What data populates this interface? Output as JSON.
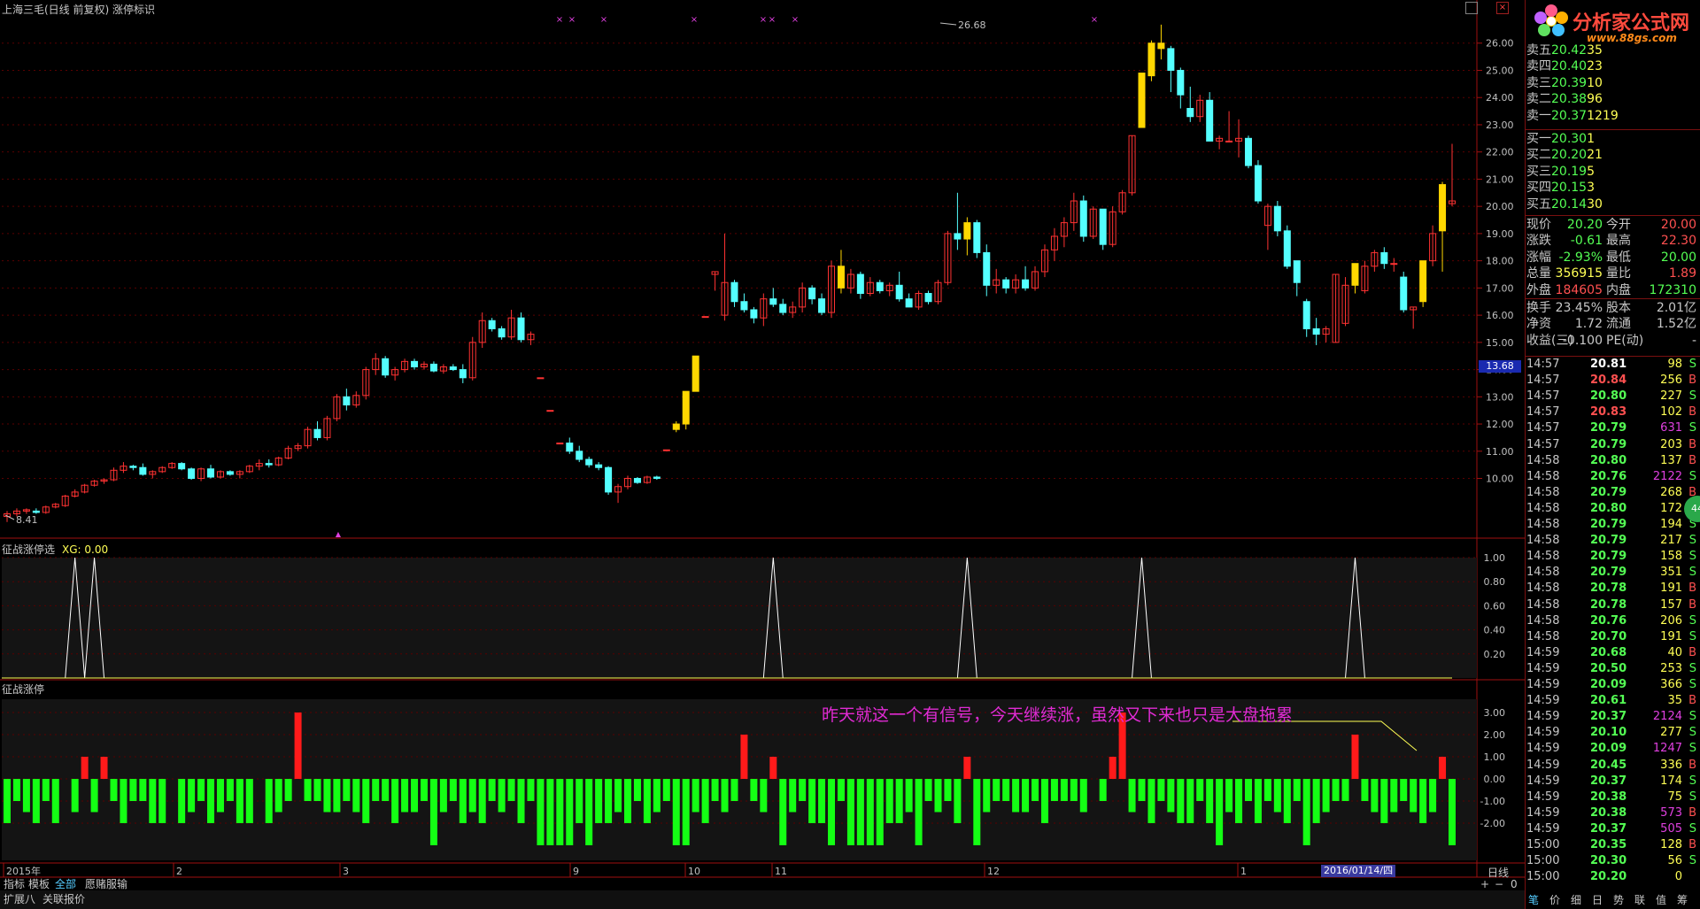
{
  "window": {
    "title": "上海三毛(日线 前复权) 涨停标识"
  },
  "colors": {
    "up": "#ff3232",
    "down": "#54ffff",
    "limit_up": "#ffd700",
    "signal_line": "#ffffff",
    "bar_positive": "#ff1a1a",
    "bar_negative": "#14ff14",
    "grid": "#5a0000",
    "annotation": "#e02bd3"
  },
  "main_chart": {
    "high_label": "26.68",
    "low_label": "8.41",
    "current_price_tag": "13.68",
    "y_ticks": [
      "26.00",
      "25.00",
      "24.00",
      "23.00",
      "22.00",
      "21.00",
      "20.00",
      "19.00",
      "18.00",
      "17.00",
      "16.00",
      "15.00",
      "14.00",
      "13.00",
      "12.00",
      "11.00",
      "10.00"
    ]
  },
  "indicator1": {
    "name": "征战涨停选",
    "xg_label": "XG: 0.00",
    "y_ticks": [
      "1.00",
      "0.80",
      "0.60",
      "0.40",
      "0.20"
    ]
  },
  "indicator2": {
    "name": "征战涨停",
    "y_ticks": [
      "3.00",
      "2.00",
      "1.00",
      "0.00",
      "-1.00",
      "-2.00"
    ],
    "annotation": "昨天就这一个有信号，今天继续涨，虽然又下来也只是大盘拖累"
  },
  "x_axis": {
    "labels": [
      "2015年",
      "2",
      "3",
      "9",
      "10",
      "11",
      "12",
      "1"
    ],
    "highlight_date": "2016/01/14/四",
    "period_label": "日线"
  },
  "tabs": [
    "指标",
    "模板",
    "全部",
    "愿赌服输"
  ],
  "bottom_bar": [
    "扩展八",
    "关联报价"
  ],
  "logo": {
    "text": "分析家公式网",
    "url": "www.88gs.com"
  },
  "quote": {
    "sell": [
      {
        "label": "卖五",
        "price": "20.42",
        "vol": "35"
      },
      {
        "label": "卖四",
        "price": "20.40",
        "vol": "23"
      },
      {
        "label": "卖三",
        "price": "20.39",
        "vol": "10"
      },
      {
        "label": "卖二",
        "price": "20.38",
        "vol": "96"
      },
      {
        "label": "卖一",
        "price": "20.37",
        "vol": "1219"
      }
    ],
    "buy": [
      {
        "label": "买一",
        "price": "20.30",
        "vol": "1"
      },
      {
        "label": "买二",
        "price": "20.20",
        "vol": "21"
      },
      {
        "label": "买三",
        "price": "20.19",
        "vol": "5"
      },
      {
        "label": "买四",
        "price": "20.15",
        "vol": "3"
      },
      {
        "label": "买五",
        "price": "20.14",
        "vol": "30"
      }
    ],
    "info": [
      {
        "l1": "现价",
        "v1": "20.20",
        "l2": "今开",
        "v2": "20.00"
      },
      {
        "l1": "涨跌",
        "v1": "-0.61",
        "l2": "最高",
        "v2": "22.30"
      },
      {
        "l1": "涨幅",
        "v1": "-2.93%",
        "l2": "最低",
        "v2": "20.00"
      },
      {
        "l1": "总量",
        "v1": "356915",
        "l2": "量比",
        "v2": "1.89"
      },
      {
        "l1": "外盘",
        "v1": "184605",
        "l2": "内盘",
        "v2": "172310"
      },
      {
        "l1": "换手",
        "v1": "23.45%",
        "l2": "股本",
        "v2": "2.01亿"
      },
      {
        "l1": "净资",
        "v1": "1.72",
        "l2": "流通",
        "v2": "1.52亿"
      },
      {
        "l1": "收益(三)",
        "v1": "-0.100",
        "l2": "PE(动)",
        "v2": "-"
      }
    ],
    "ticks": [
      {
        "t": "14:57",
        "p": "20.81",
        "v": "98",
        "s": "S"
      },
      {
        "t": "14:57",
        "p": "20.84",
        "v": "256",
        "s": "B"
      },
      {
        "t": "14:57",
        "p": "20.80",
        "v": "227",
        "s": "S"
      },
      {
        "t": "14:57",
        "p": "20.83",
        "v": "102",
        "s": "B"
      },
      {
        "t": "14:57",
        "p": "20.79",
        "v": "631",
        "s": "S"
      },
      {
        "t": "14:57",
        "p": "20.79",
        "v": "203",
        "s": "B"
      },
      {
        "t": "14:58",
        "p": "20.80",
        "v": "137",
        "s": "B"
      },
      {
        "t": "14:58",
        "p": "20.76",
        "v": "2122",
        "s": "S"
      },
      {
        "t": "14:58",
        "p": "20.79",
        "v": "268",
        "s": "B"
      },
      {
        "t": "14:58",
        "p": "20.80",
        "v": "172",
        "s": "B"
      },
      {
        "t": "14:58",
        "p": "20.79",
        "v": "194",
        "s": "S"
      },
      {
        "t": "14:58",
        "p": "20.79",
        "v": "217",
        "s": "S"
      },
      {
        "t": "14:58",
        "p": "20.79",
        "v": "158",
        "s": "S"
      },
      {
        "t": "14:58",
        "p": "20.79",
        "v": "351",
        "s": "S"
      },
      {
        "t": "14:58",
        "p": "20.78",
        "v": "191",
        "s": "B"
      },
      {
        "t": "14:58",
        "p": "20.78",
        "v": "157",
        "s": "B"
      },
      {
        "t": "14:58",
        "p": "20.76",
        "v": "206",
        "s": "S"
      },
      {
        "t": "14:58",
        "p": "20.70",
        "v": "191",
        "s": "S"
      },
      {
        "t": "14:59",
        "p": "20.68",
        "v": "40",
        "s": "B"
      },
      {
        "t": "14:59",
        "p": "20.50",
        "v": "253",
        "s": "S"
      },
      {
        "t": "14:59",
        "p": "20.09",
        "v": "366",
        "s": "S"
      },
      {
        "t": "14:59",
        "p": "20.61",
        "v": "35",
        "s": "B"
      },
      {
        "t": "14:59",
        "p": "20.37",
        "v": "2124",
        "s": "S"
      },
      {
        "t": "14:59",
        "p": "20.10",
        "v": "277",
        "s": "S"
      },
      {
        "t": "14:59",
        "p": "20.09",
        "v": "1247",
        "s": "S"
      },
      {
        "t": "14:59",
        "p": "20.45",
        "v": "336",
        "s": "B"
      },
      {
        "t": "14:59",
        "p": "20.37",
        "v": "174",
        "s": "S"
      },
      {
        "t": "14:59",
        "p": "20.38",
        "v": "75",
        "s": "S"
      },
      {
        "t": "14:59",
        "p": "20.38",
        "v": "573",
        "s": "B"
      },
      {
        "t": "14:59",
        "p": "20.37",
        "v": "505",
        "s": "S"
      },
      {
        "t": "15:00",
        "p": "20.35",
        "v": "128",
        "s": "B"
      },
      {
        "t": "15:00",
        "p": "20.30",
        "v": "56",
        "s": "S"
      },
      {
        "t": "15:00",
        "p": "20.20",
        "v": "0",
        "s": ""
      }
    ],
    "bottom_tabs": [
      "笔",
      "价",
      "细",
      "日",
      "势",
      "联",
      "值",
      "筹"
    ]
  },
  "badge": "44",
  "chart_data": {
    "type": "candlestick",
    "candles": [
      [
        8.6,
        8.8,
        8.4,
        8.7
      ],
      [
        8.7,
        8.9,
        8.6,
        8.8
      ],
      [
        8.8,
        8.9,
        8.7,
        8.85
      ],
      [
        8.8,
        8.9,
        8.7,
        8.75
      ],
      [
        8.75,
        9.0,
        8.7,
        8.95
      ],
      [
        8.95,
        9.1,
        8.9,
        9.05
      ],
      [
        9.0,
        9.4,
        8.95,
        9.35
      ],
      [
        9.35,
        9.6,
        9.3,
        9.5
      ],
      [
        9.5,
        9.8,
        9.45,
        9.75
      ],
      [
        9.75,
        9.95,
        9.7,
        9.9
      ],
      [
        9.9,
        10.0,
        9.8,
        9.95
      ],
      [
        9.95,
        10.4,
        9.9,
        10.3
      ],
      [
        10.3,
        10.6,
        10.2,
        10.45
      ],
      [
        10.45,
        10.5,
        10.3,
        10.4
      ],
      [
        10.4,
        10.55,
        10.1,
        10.15
      ],
      [
        10.15,
        10.3,
        10.0,
        10.25
      ],
      [
        10.25,
        10.45,
        10.2,
        10.4
      ],
      [
        10.4,
        10.6,
        10.35,
        10.55
      ],
      [
        10.55,
        10.6,
        10.3,
        10.35
      ],
      [
        10.35,
        10.4,
        9.95,
        10.0
      ],
      [
        10.0,
        10.4,
        9.9,
        10.35
      ],
      [
        10.35,
        10.5,
        10.0,
        10.05
      ],
      [
        10.05,
        10.3,
        10.0,
        10.25
      ],
      [
        10.25,
        10.3,
        10.1,
        10.15
      ],
      [
        10.15,
        10.3,
        10.0,
        10.25
      ],
      [
        10.25,
        10.5,
        10.2,
        10.45
      ],
      [
        10.45,
        10.7,
        10.3,
        10.55
      ],
      [
        10.55,
        10.7,
        10.4,
        10.5
      ],
      [
        10.5,
        10.8,
        10.45,
        10.75
      ],
      [
        10.75,
        11.2,
        10.7,
        11.1
      ],
      [
        11.1,
        11.3,
        11.0,
        11.2
      ],
      [
        11.2,
        11.9,
        11.1,
        11.8
      ],
      [
        11.8,
        12.1,
        11.4,
        11.5
      ],
      [
        11.5,
        12.3,
        11.4,
        12.2
      ],
      [
        12.2,
        13.1,
        12.1,
        13.0
      ],
      [
        13.0,
        13.3,
        12.5,
        12.7
      ],
      [
        12.7,
        13.2,
        12.6,
        13.05
      ],
      [
        13.05,
        14.1,
        12.9,
        14.0
      ],
      [
        14.0,
        14.6,
        13.8,
        14.4
      ],
      [
        14.4,
        14.5,
        13.7,
        13.8
      ],
      [
        13.8,
        14.1,
        13.6,
        14.0
      ],
      [
        14.0,
        14.4,
        13.9,
        14.3
      ],
      [
        14.3,
        14.4,
        14.0,
        14.1
      ],
      [
        14.1,
        14.3,
        14.0,
        14.2
      ],
      [
        14.2,
        14.3,
        13.9,
        13.95
      ],
      [
        13.95,
        14.2,
        13.85,
        14.1
      ],
      [
        14.1,
        14.2,
        13.95,
        14.0
      ],
      [
        14.0,
        14.2,
        13.5,
        13.7
      ],
      [
        13.7,
        15.2,
        13.6,
        15.0
      ],
      [
        15.0,
        16.1,
        14.8,
        15.8
      ],
      [
        15.8,
        15.9,
        15.4,
        15.5
      ],
      [
        15.5,
        15.6,
        15.1,
        15.2
      ],
      [
        15.2,
        16.2,
        15.1,
        15.9
      ],
      [
        15.9,
        16.1,
        15.0,
        15.1
      ],
      [
        15.1,
        15.4,
        14.9,
        15.3
      ],
      [
        13.7,
        13.7,
        13.7,
        13.7
      ],
      [
        12.5,
        12.5,
        12.5,
        12.5
      ],
      [
        11.3,
        11.3,
        11.3,
        11.3
      ],
      [
        11.3,
        11.5,
        10.9,
        11.0
      ],
      [
        11.0,
        11.2,
        10.6,
        10.7
      ],
      [
        10.7,
        10.8,
        10.4,
        10.5
      ],
      [
        10.5,
        10.6,
        10.3,
        10.4
      ],
      [
        10.4,
        10.45,
        9.4,
        9.5
      ],
      [
        9.5,
        9.8,
        9.1,
        9.7
      ],
      [
        9.7,
        10.1,
        9.6,
        10.0
      ],
      [
        10.0,
        10.05,
        9.8,
        9.85
      ],
      [
        9.85,
        10.1,
        9.8,
        10.05
      ],
      [
        10.05,
        10.1,
        9.95,
        10.0
      ],
      [
        11.05,
        11.05,
        11.05,
        11.05
      ],
      [
        11.8,
        12.1,
        11.7,
        12.0
      ],
      [
        12.0,
        13.2,
        11.8,
        13.2
      ],
      [
        13.2,
        14.5,
        13.2,
        14.5
      ],
      [
        15.95,
        15.95,
        15.95,
        15.95
      ],
      [
        17.5,
        17.6,
        16.9,
        17.6
      ],
      [
        16.0,
        19.0,
        15.8,
        17.2
      ],
      [
        17.2,
        17.3,
        16.3,
        16.5
      ],
      [
        16.5,
        16.8,
        16.1,
        16.2
      ],
      [
        16.2,
        16.3,
        15.7,
        15.9
      ],
      [
        15.9,
        16.8,
        15.6,
        16.6
      ],
      [
        16.6,
        17.0,
        16.3,
        16.4
      ],
      [
        16.4,
        16.6,
        16.0,
        16.1
      ],
      [
        16.1,
        16.5,
        15.9,
        16.3
      ],
      [
        16.3,
        17.2,
        16.1,
        17.0
      ],
      [
        17.0,
        17.1,
        16.4,
        16.6
      ],
      [
        16.6,
        16.8,
        16.0,
        16.1
      ],
      [
        16.1,
        18.0,
        15.9,
        17.8
      ],
      [
        17.8,
        18.4,
        16.8,
        17.0
      ],
      [
        17.0,
        17.7,
        16.8,
        17.5
      ],
      [
        17.5,
        17.6,
        16.6,
        16.8
      ],
      [
        16.8,
        17.4,
        16.7,
        17.2
      ],
      [
        17.2,
        17.3,
        16.8,
        16.9
      ],
      [
        16.9,
        17.2,
        16.7,
        17.1
      ],
      [
        17.1,
        17.6,
        16.5,
        16.6
      ],
      [
        16.6,
        16.8,
        16.3,
        16.3
      ],
      [
        16.3,
        16.9,
        16.2,
        16.8
      ],
      [
        16.8,
        16.9,
        16.4,
        16.5
      ],
      [
        16.5,
        17.3,
        16.4,
        17.2
      ],
      [
        17.2,
        19.1,
        17.1,
        19.0
      ],
      [
        19.0,
        20.5,
        18.4,
        18.8
      ],
      [
        18.8,
        19.6,
        18.2,
        19.4
      ],
      [
        19.4,
        19.5,
        18.1,
        18.3
      ],
      [
        18.3,
        18.6,
        16.7,
        17.1
      ],
      [
        17.1,
        17.7,
        16.8,
        17.3
      ],
      [
        17.3,
        17.4,
        16.8,
        17.0
      ],
      [
        17.0,
        17.5,
        16.8,
        17.3
      ],
      [
        17.3,
        17.8,
        16.9,
        17.0
      ],
      [
        17.0,
        17.8,
        16.9,
        17.6
      ],
      [
        17.6,
        18.6,
        17.4,
        18.4
      ],
      [
        18.4,
        19.2,
        18.0,
        18.9
      ],
      [
        18.9,
        19.6,
        18.5,
        19.4
      ],
      [
        19.4,
        20.5,
        19.1,
        20.2
      ],
      [
        20.2,
        20.4,
        18.7,
        18.9
      ],
      [
        18.9,
        20.0,
        18.8,
        19.9
      ],
      [
        19.9,
        19.9,
        18.4,
        18.6
      ],
      [
        18.6,
        20.0,
        18.5,
        19.8
      ],
      [
        19.8,
        20.6,
        19.7,
        20.5
      ],
      [
        20.5,
        22.6,
        20.4,
        22.6
      ],
      [
        22.9,
        24.9,
        22.9,
        24.9
      ],
      [
        24.8,
        26.1,
        24.6,
        26.0
      ],
      [
        26.0,
        26.68,
        25.4,
        25.8
      ],
      [
        25.8,
        25.9,
        24.2,
        25.0
      ],
      [
        25.0,
        25.1,
        23.6,
        24.1
      ],
      [
        23.6,
        24.4,
        23.1,
        23.3
      ],
      [
        23.3,
        24.1,
        23.1,
        23.9
      ],
      [
        23.9,
        24.2,
        22.6,
        22.4
      ],
      [
        22.4,
        22.6,
        22.1,
        22.5
      ],
      [
        22.4,
        23.5,
        22.4,
        22.4
      ],
      [
        22.4,
        23.2,
        21.8,
        22.5
      ],
      [
        22.5,
        22.6,
        21.4,
        21.5
      ],
      [
        21.5,
        21.7,
        20.1,
        20.2
      ],
      [
        19.3,
        20.1,
        18.4,
        20.0
      ],
      [
        20.0,
        20.2,
        18.9,
        19.1
      ],
      [
        19.1,
        19.3,
        17.7,
        17.8
      ],
      [
        18.0,
        18.0,
        16.7,
        17.2
      ],
      [
        16.5,
        16.6,
        15.2,
        15.5
      ],
      [
        15.5,
        15.9,
        14.9,
        15.3
      ],
      [
        15.3,
        15.6,
        15.0,
        15.5
      ],
      [
        15.0,
        17.5,
        15.0,
        17.5
      ],
      [
        15.7,
        17.4,
        15.6,
        17.1
      ],
      [
        17.1,
        17.8,
        16.8,
        17.9
      ],
      [
        16.9,
        18.0,
        16.8,
        17.8
      ],
      [
        17.8,
        18.4,
        17.6,
        18.3
      ],
      [
        18.3,
        18.5,
        17.7,
        17.9
      ],
      [
        17.9,
        18.1,
        17.6,
        17.9
      ],
      [
        17.4,
        17.6,
        16.1,
        16.2
      ],
      [
        16.2,
        16.3,
        15.5,
        16.3
      ],
      [
        16.5,
        18.0,
        16.3,
        18.0
      ],
      [
        18.0,
        19.3,
        17.8,
        19.0
      ],
      [
        19.1,
        20.9,
        17.6,
        20.8
      ],
      [
        20.1,
        22.3,
        20.0,
        20.2
      ]
    ],
    "signal_peaks": [
      7,
      9,
      79,
      99,
      117,
      139,
      150
    ],
    "bars": [
      -2.0,
      -1.0,
      -1.5,
      -2.0,
      -1.0,
      -2.0,
      0,
      -1.5,
      1.0,
      -1.5,
      1.0,
      -1.0,
      -2.0,
      -1.0,
      -1.0,
      -2.0,
      -2.0,
      0,
      -2.0,
      -1.5,
      -1.0,
      -2.0,
      -1.5,
      -1.0,
      -2.0,
      -2.0,
      0,
      -2.0,
      -1.5,
      -1.0,
      3.0,
      -1.0,
      -1.0,
      -1.5,
      -1.5,
      -1.0,
      -1.5,
      -2.0,
      -1.0,
      -1.0,
      -2.0,
      -1.5,
      -1.5,
      -1.0,
      -3.0,
      -1.5,
      -1.0,
      -2.0,
      -1.5,
      -2.0,
      -1.0,
      -1.5,
      -1.0,
      -2.0,
      -1.0,
      -3.0,
      -3.0,
      -3.0,
      -3.0,
      -2.0,
      -3.0,
      -2.0,
      -2.0,
      -1.5,
      -2.0,
      -1.0,
      -2.0,
      -1.5,
      -1.0,
      -3.0,
      -3.0,
      -1.5,
      -2.0,
      -1.0,
      -1.5,
      -1.0,
      2.0,
      -1.0,
      -1.5,
      1.0,
      -3.0,
      -1.5,
      -1.0,
      -2.0,
      -2.0,
      -3.0,
      -1.0,
      -3.0,
      -3.0,
      -3.0,
      -3.0,
      -2.0,
      -2.0,
      -1.5,
      -3.0,
      -1.0,
      -1.5,
      -1.0,
      -2.0,
      1.0,
      -3.0,
      -1.5,
      -1.0,
      -1.0,
      -1.5,
      -1.5,
      -1.0,
      -2.0,
      -1.0,
      -1.0,
      -1.0,
      -1.5,
      0,
      -1.0,
      1.0,
      3.0,
      -1.5,
      -1.0,
      -2.0,
      -1.0,
      -1.5,
      -2.0,
      -2.0,
      -1.0,
      -2.0,
      -3.0,
      -1.5,
      -2.0,
      -1.0,
      -2.0,
      -1.0,
      -1.5,
      -2.0,
      -1.0,
      -3.0,
      -2.0,
      -1.5,
      -1.0,
      -1.0,
      2.0,
      -1.0,
      -1.5,
      -2.0,
      -1.5,
      -1.0,
      -1.5,
      -2.0,
      -1.5,
      1.0,
      -3.0
    ],
    "ylim": [
      8.0,
      27.0
    ]
  }
}
